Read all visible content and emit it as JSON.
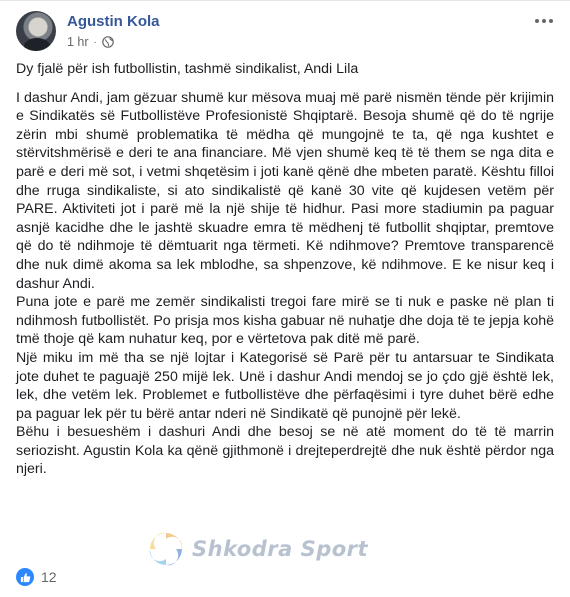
{
  "post": {
    "author": "Agustin Kola",
    "time": "1 hr",
    "separator": "·",
    "privacy_icon": "globe-icon",
    "more_icon": "ellipsis-icon",
    "headline": "Dy fjalë për ish futbollistin, tashmë sindikalist, Andi Lila",
    "paragraphs": [
      "I dashur Andi, jam gëzuar shumë kur mësova muaj më parë nismën tënde për krijimin e Sindikatës së Futbollistëve Profesionistë Shqiptarë. Besoja shumë që do të ngrije zërin mbi shumë problematika të mëdha që mungojnë te ta, që nga kushtet e stërvitshmërisë e deri te ana financiare. Më vjen shumë keq të të them se nga dita e parë e deri më sot, i vetmi shqetësim i joti kanë qënë dhe mbeten paratë. Kështu filloi dhe rruga sindikaliste, si ato sindikalistë që kanë 30 vite që kujdesen vetëm për PARE. Aktiviteti jot i parë më la një shije të hidhur. Pasi more stadiumin pa paguar asnjë kacidhe dhe le jashtë skuadre emra të mëdhenj të futbollit shqiptar, premtove që do të ndihmoje të dëmtuarit nga tërmeti. Kë ndihmove? Premtove transparencë dhe nuk dimë akoma sa lek mblodhe, sa shpenzove, kë ndihmove. E ke nisur keq i dashur Andi.",
      "Puna jote e parë me zemër sindikalisti tregoi fare mirë se ti nuk e paske në plan ti ndihmosh futbollistët. Po prisja mos kisha gabuar në nuhatje dhe doja të te jepja kohë tmë thoje që kam nuhatur keq, por e vërtetova pak ditë më parë.",
      "Një miku im më tha se një lojtar i Kategorisë së Parë për tu antarsuar te Sindikata jote duhet te paguajë 250 mijë lek. Unë i dashur Andi mendoj se jo çdo gjë është lek, lek, dhe vetëm lek. Problemet e futbollistëve dhe përfaqësimi i tyre duhet bërë edhe pa paguar lek për tu bërë antar nderi në Sindikatë që punojnë për lekë.",
      "Bëhu i besueshëm i dashuri Andi dhe besoj se në atë moment do të të marrin seriozisht. Agustin Kola ka qënë gjithmonë i drejteperdrejtë dhe nuk është përdor nga njeri."
    ]
  },
  "watermark": {
    "text": "Shkodra Sport",
    "logo_icon": "swirl-logo-icon"
  },
  "reactions": {
    "icon": "like-icon",
    "count": "12",
    "color": "#2d88ff"
  }
}
